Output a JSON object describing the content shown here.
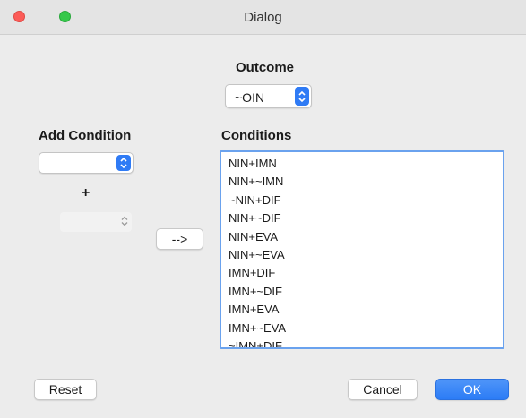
{
  "window": {
    "title": "Dialog"
  },
  "outcome": {
    "label": "Outcome",
    "selected": "~OIN"
  },
  "add_condition": {
    "label": "Add Condition",
    "selected": "",
    "plus": "+",
    "stepper_value": ""
  },
  "arrow_button": {
    "label": "-->"
  },
  "conditions": {
    "label": "Conditions",
    "items": [
      "NIN+IMN",
      "NIN+~IMN",
      "~NIN+DIF",
      "NIN+~DIF",
      "NIN+EVA",
      "NIN+~EVA",
      "IMN+DIF",
      "IMN+~DIF",
      "IMN+EVA",
      "IMN+~EVA",
      "~IMN+DIF"
    ]
  },
  "buttons": {
    "reset": "Reset",
    "cancel": "Cancel",
    "ok": "OK"
  },
  "colors": {
    "accent": "#2f7bf5",
    "close": "#fc5b57",
    "zoom": "#35c84a",
    "list_focus": "#6aa2ee"
  }
}
